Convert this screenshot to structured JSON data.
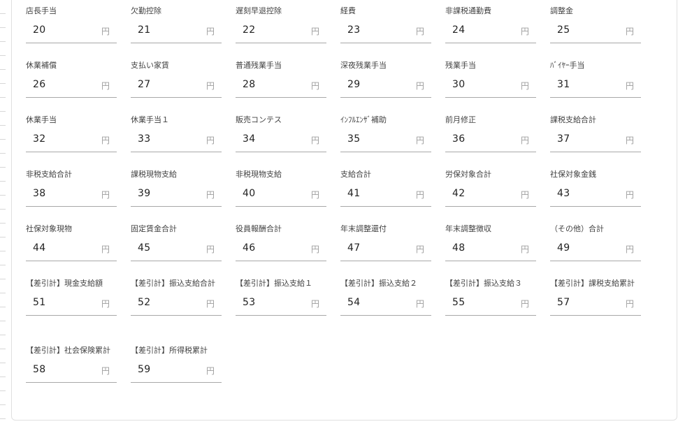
{
  "form": {
    "rows": [
      [
        {
          "label": "店長手当",
          "value": "20",
          "unit": "円"
        },
        {
          "label": "欠勤控除",
          "value": "21",
          "unit": "円"
        },
        {
          "label": "遅刻早退控除",
          "value": "22",
          "unit": "円"
        },
        {
          "label": "経費",
          "value": "23",
          "unit": "円"
        },
        {
          "label": "非課税通勤費",
          "value": "24",
          "unit": "円"
        },
        {
          "label": "調整金",
          "value": "25",
          "unit": "円"
        }
      ],
      [
        {
          "label": "休業補償",
          "value": "26",
          "unit": "円"
        },
        {
          "label": "支払い家賃",
          "value": "27",
          "unit": "円"
        },
        {
          "label": "普通残業手当",
          "value": "28",
          "unit": "円"
        },
        {
          "label": "深夜残業手当",
          "value": "29",
          "unit": "円"
        },
        {
          "label": "残業手当",
          "value": "30",
          "unit": "円"
        },
        {
          "label": "ﾊﾞｲﾔｰ手当",
          "value": "31",
          "unit": "円"
        }
      ],
      [
        {
          "label": "休業手当",
          "value": "32",
          "unit": "円"
        },
        {
          "label": "休業手当１",
          "value": "33",
          "unit": "円"
        },
        {
          "label": "販売コンテス",
          "value": "34",
          "unit": "円"
        },
        {
          "label": "ｲﾝﾌﾙｴﾝｻﾞ補助",
          "value": "35",
          "unit": "円"
        },
        {
          "label": "前月修正",
          "value": "36",
          "unit": "円"
        },
        {
          "label": "課税支給合計",
          "value": "37",
          "unit": "円"
        }
      ],
      [
        {
          "label": "非税支給合計",
          "value": "38",
          "unit": "円"
        },
        {
          "label": "課税現物支給",
          "value": "39",
          "unit": "円"
        },
        {
          "label": "非税現物支給",
          "value": "40",
          "unit": "円"
        },
        {
          "label": "支給合計",
          "value": "41",
          "unit": "円"
        },
        {
          "label": "労保対象合計",
          "value": "42",
          "unit": "円"
        },
        {
          "label": "社保対象金銭",
          "value": "43",
          "unit": "円"
        }
      ],
      [
        {
          "label": "社保対象現物",
          "value": "44",
          "unit": "円"
        },
        {
          "label": "固定賃金合計",
          "value": "45",
          "unit": "円"
        },
        {
          "label": "役員報酬合計",
          "value": "46",
          "unit": "円"
        },
        {
          "label": "年末調整還付",
          "value": "47",
          "unit": "円"
        },
        {
          "label": "年末調整徴収",
          "value": "48",
          "unit": "円"
        },
        {
          "label": "（その他）合計",
          "value": "49",
          "unit": "円"
        }
      ],
      [
        {
          "label": "【差引計】現金支給額",
          "value": "51",
          "unit": "円"
        },
        {
          "label": "【差引計】振込支給合計",
          "value": "52",
          "unit": "円"
        },
        {
          "label": "【差引計】振込支給１",
          "value": "53",
          "unit": "円"
        },
        {
          "label": "【差引計】振込支給２",
          "value": "54",
          "unit": "円"
        },
        {
          "label": "【差引計】振込支給３",
          "value": "55",
          "unit": "円"
        },
        {
          "label": "【差引計】課税支給累計",
          "value": "57",
          "unit": "円"
        }
      ],
      [
        {
          "label": "【差引計】社会保険累計",
          "value": "58",
          "unit": "円"
        },
        {
          "label": "【差引計】所得税累計",
          "value": "59",
          "unit": "円"
        }
      ]
    ]
  }
}
